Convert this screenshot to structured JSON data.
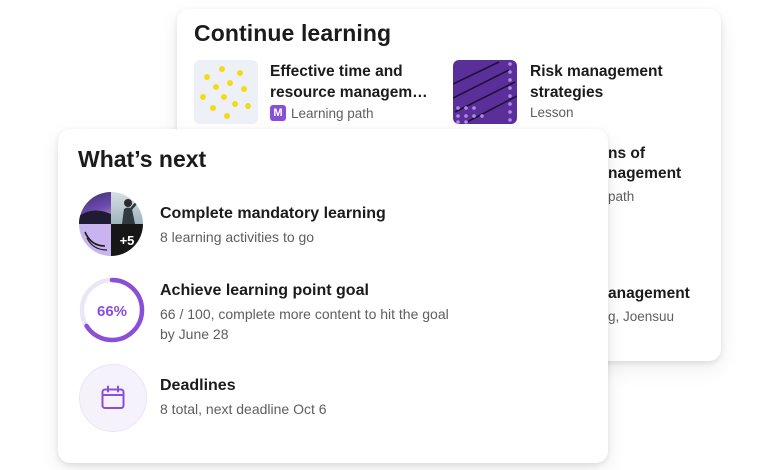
{
  "continue": {
    "title": "Continue learning",
    "items": [
      {
        "title_line1": "Effective time and",
        "title_line2": "resource managem…",
        "badge": "M",
        "meta": "Learning path"
      },
      {
        "title_line1": "Risk management",
        "title_line2": "strategies",
        "meta": "Lesson"
      }
    ],
    "peek": {
      "line1": "ns of",
      "line2": "nagement",
      "line3": "path",
      "line4": "anagement",
      "line5": "g, Joensuu"
    }
  },
  "next": {
    "title": "What’s next",
    "mandatory": {
      "title": "Complete mandatory learning",
      "subtitle": "8 learning activities to go",
      "more_count": "+5"
    },
    "goal": {
      "title": "Achieve learning point goal",
      "subtitle_line1": "66 / 100, complete more content to hit the goal",
      "subtitle_line2": "by June 28",
      "percent_label": "66%",
      "progress": 0.66
    },
    "deadlines": {
      "title": "Deadlines",
      "subtitle": "8 total, next deadline Oct 6"
    }
  },
  "colors": {
    "accent": "#8a4fd8",
    "ring_track": "#ece5f6",
    "lesson_bg": "#5a2f99"
  },
  "icons": {
    "calendar": "calendar-icon",
    "badge": "learning-path-icon"
  }
}
